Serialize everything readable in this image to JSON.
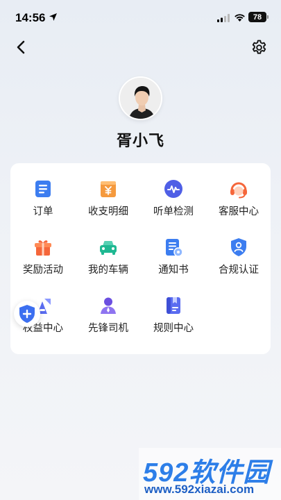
{
  "status_bar": {
    "time": "14:56",
    "battery": "78"
  },
  "profile": {
    "name": "胥小飞"
  },
  "menu": {
    "items": [
      {
        "label": "订单",
        "icon": "order-list-icon"
      },
      {
        "label": "收支明细",
        "icon": "wallet-yuan-icon"
      },
      {
        "label": "听单检测",
        "icon": "waveform-icon"
      },
      {
        "label": "客服中心",
        "icon": "headset-icon"
      },
      {
        "label": "奖励活动",
        "icon": "gift-box-icon"
      },
      {
        "label": "我的车辆",
        "icon": "car-icon"
      },
      {
        "label": "通知书",
        "icon": "notice-doc-icon"
      },
      {
        "label": "合规认证",
        "icon": "shield-user-icon"
      },
      {
        "label": "权益中心",
        "icon": "rights-center-icon"
      },
      {
        "label": "先锋司机",
        "icon": "driver-icon"
      },
      {
        "label": "规则中心",
        "icon": "rulebook-icon"
      }
    ]
  },
  "watermark": {
    "title": "592软件园",
    "url": "www.592xiazai.com"
  },
  "colors": {
    "accent_blue": "#3c7df0",
    "orange": "#f58a3c",
    "background": "#eef1f6"
  }
}
